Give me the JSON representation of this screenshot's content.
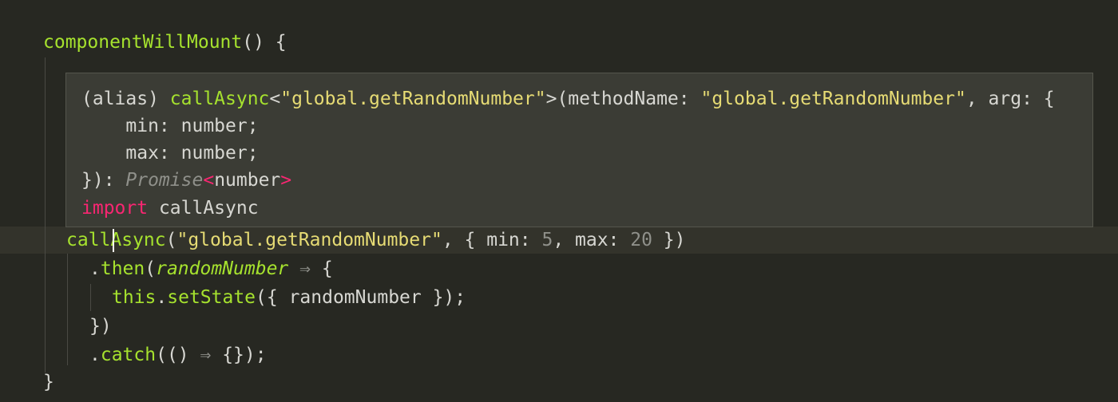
{
  "editor": {
    "method_header": "componentWillMount",
    "method_header_rest": "() {",
    "closing_brace": "}",
    "call_line": {
      "fn": "callAsync",
      "open": "(",
      "string": "\"global.getRandomNumber\"",
      "mid": ", { min: ",
      "num1": "5",
      "mid2": ", max: ",
      "num2": "20",
      "end": " })"
    },
    "then_line": {
      "dot": ".",
      "method": "then",
      "open": "(",
      "param": "randomNumber",
      "arrow": " ⇒ ",
      "brace": "{"
    },
    "setstate_line": {
      "this": "this",
      "dot": ".",
      "method": "setState",
      "rest": "({ randomNumber });"
    },
    "close_then": "})",
    "catch_line": {
      "dot": ".",
      "method": "catch",
      "open": "(() ",
      "arrow": "⇒",
      "rest": " {});"
    }
  },
  "hover": {
    "line1": {
      "alias": "(alias) ",
      "fn": "callAsync",
      "lt": "<",
      "generic": "\"global.getRandomNumber\"",
      "gt_paren": ">(methodName: ",
      "arg_str": "\"global.getRandomNumber\"",
      "rest": ", arg: {"
    },
    "line2": "    min: number;",
    "line3": "    max: number;",
    "line4": {
      "close": "}): ",
      "promise": "Promise",
      "lt": "<",
      "type": "number",
      "gt": ">"
    },
    "line5": {
      "kw": "import",
      "name": " callAsync"
    }
  }
}
